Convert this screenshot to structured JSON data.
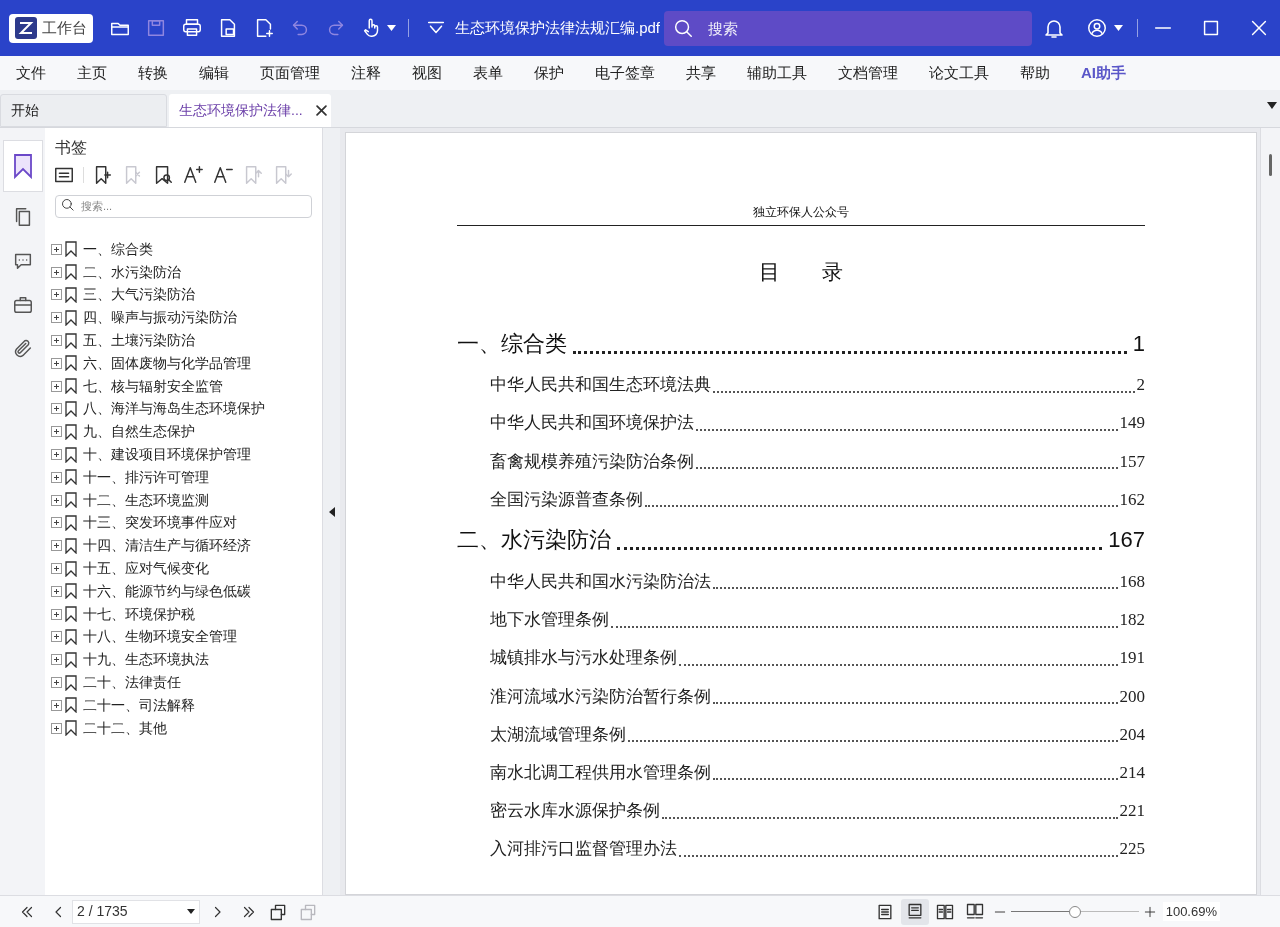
{
  "title_bar": {
    "workbench_button": "工作台",
    "file_name": "生态环境保护法律法规汇编.pdf",
    "search": {
      "placeholder": "搜索"
    }
  },
  "menu": [
    {
      "label": "文件",
      "kind": "plain"
    },
    {
      "label": "主页",
      "kind": "plain"
    },
    {
      "label": "转换",
      "kind": "plain"
    },
    {
      "label": "编辑",
      "kind": "plain"
    },
    {
      "label": "页面管理",
      "kind": "plain"
    },
    {
      "label": "注释",
      "kind": "plain"
    },
    {
      "label": "视图",
      "kind": "plain"
    },
    {
      "label": "表单",
      "kind": "plain"
    },
    {
      "label": "保护",
      "kind": "plain"
    },
    {
      "label": "电子签章",
      "kind": "plain"
    },
    {
      "label": "共享",
      "kind": "plain"
    },
    {
      "label": "辅助工具",
      "kind": "plain"
    },
    {
      "label": "文档管理",
      "kind": "plain"
    },
    {
      "label": "论文工具",
      "kind": "plain"
    },
    {
      "label": "帮助",
      "kind": "plain"
    },
    {
      "label": "AI助手",
      "kind": "ai"
    }
  ],
  "tabs": [
    {
      "label": "开始",
      "selected": false,
      "closable": false
    },
    {
      "label": "生态环境保护法律...",
      "selected": true,
      "closable": true
    }
  ],
  "bookmarks_panel": {
    "title": "书签",
    "search": {
      "placeholder": "搜索..."
    },
    "items": [
      {
        "label": "一、综合类",
        "expanded": false
      },
      {
        "label": "二、水污染防治",
        "expanded": false
      },
      {
        "label": "三、大气污染防治",
        "expanded": false
      },
      {
        "label": "四、噪声与振动污染防治",
        "expanded": false
      },
      {
        "label": "五、土壤污染防治",
        "expanded": false
      },
      {
        "label": "六、固体废物与化学品管理",
        "expanded": false
      },
      {
        "label": "七、核与辐射安全监管",
        "expanded": false
      },
      {
        "label": "八、海洋与海岛生态环境保护",
        "expanded": false
      },
      {
        "label": "九、自然生态保护",
        "expanded": false
      },
      {
        "label": "十、建设项目环境保护管理",
        "expanded": false
      },
      {
        "label": "十一、排污许可管理",
        "expanded": false
      },
      {
        "label": "十二、生态环境监测",
        "expanded": false
      },
      {
        "label": "十三、突发环境事件应对",
        "expanded": false
      },
      {
        "label": "十四、清洁生产与循环经济",
        "expanded": false
      },
      {
        "label": "十五、应对气候变化",
        "expanded": false
      },
      {
        "label": "十六、能源节约与绿色低碳",
        "expanded": false
      },
      {
        "label": "十七、环境保护税",
        "expanded": false
      },
      {
        "label": "十八、生物环境安全管理",
        "expanded": false
      },
      {
        "label": "十九、生态环境执法",
        "expanded": false
      },
      {
        "label": "二十、法律责任",
        "expanded": false
      },
      {
        "label": "二十一、司法解释",
        "expanded": false
      },
      {
        "label": "二十二、其他",
        "expanded": false
      }
    ]
  },
  "document": {
    "header": "独立环保人公众号",
    "heading": "目　　录",
    "toc": [
      {
        "kind": "section",
        "title": "一、综合类",
        "page": "1"
      },
      {
        "kind": "entry",
        "title": "中华人民共和国生态环境法典",
        "page": "2"
      },
      {
        "kind": "entry",
        "title": "中华人民共和国环境保护法",
        "page": "149"
      },
      {
        "kind": "entry",
        "title": "畜禽规模养殖污染防治条例",
        "page": "157"
      },
      {
        "kind": "entry",
        "title": "全国污染源普查条例",
        "page": "162"
      },
      {
        "kind": "section",
        "title": "二、水污染防治",
        "page": "167"
      },
      {
        "kind": "entry",
        "title": "中华人民共和国水污染防治法",
        "page": "168"
      },
      {
        "kind": "entry",
        "title": "地下水管理条例",
        "page": "182"
      },
      {
        "kind": "entry",
        "title": "城镇排水与污水处理条例",
        "page": "191"
      },
      {
        "kind": "entry",
        "title": "淮河流域水污染防治暂行条例",
        "page": "200"
      },
      {
        "kind": "entry",
        "title": "太湖流域管理条例",
        "page": "204"
      },
      {
        "kind": "entry",
        "title": "南水北调工程供用水管理条例",
        "page": "214"
      },
      {
        "kind": "entry",
        "title": "密云水库水源保护条例",
        "page": "221"
      },
      {
        "kind": "entry",
        "title": "入河排污口监督管理办法",
        "page": "225"
      }
    ]
  },
  "status_bar": {
    "page_field": "2 / 1735",
    "view_modes": [
      {
        "selected": false
      },
      {
        "selected": true
      },
      {
        "selected": false
      },
      {
        "selected": false
      }
    ],
    "zoom": {
      "level": 0.5,
      "reading": "100.69%"
    }
  }
}
